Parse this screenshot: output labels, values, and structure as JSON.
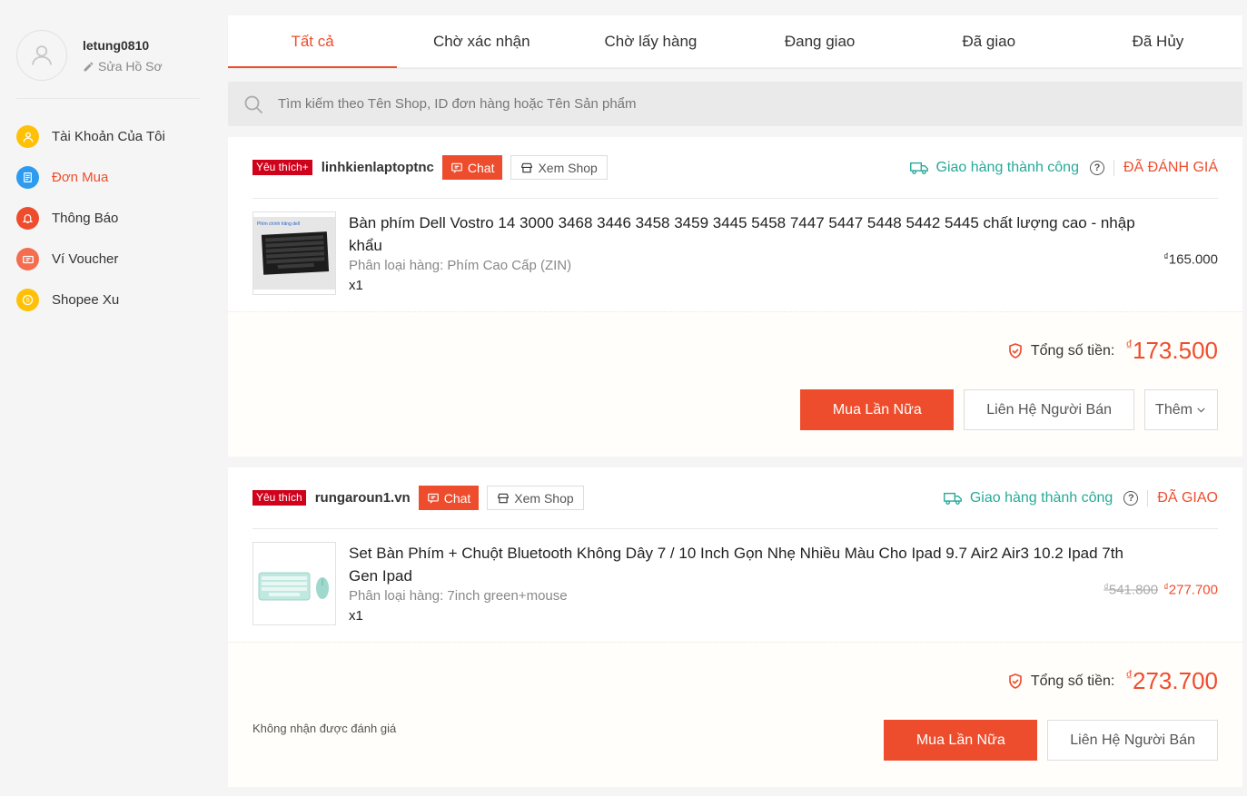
{
  "sidebar": {
    "username": "letung0810",
    "edit_label": "Sửa Hồ Sơ",
    "items": [
      {
        "label": "Tài Khoản Của Tôi",
        "icon": "user-icon",
        "color": "#ffc107"
      },
      {
        "label": "Đơn Mua",
        "icon": "clipboard-icon",
        "color": "#2d9cf0"
      },
      {
        "label": "Thông Báo",
        "icon": "bell-icon",
        "color": "#ee4d2d"
      },
      {
        "label": "Ví Voucher",
        "icon": "ticket-icon",
        "color": "#f56d4f"
      },
      {
        "label": "Shopee Xu",
        "icon": "coin-icon",
        "color": "#ffc107"
      }
    ]
  },
  "tabs": [
    "Tất cả",
    "Chờ xác nhận",
    "Chờ lấy hàng",
    "Đang giao",
    "Đã giao",
    "Đã Hủy"
  ],
  "search": {
    "placeholder": "Tìm kiếm theo Tên Shop, ID đơn hàng hoặc Tên Sản phẩm"
  },
  "orders": [
    {
      "badge": "Yêu thích+",
      "shop": "linhkienlaptoptnc",
      "chat": "Chat",
      "view_shop": "Xem Shop",
      "delivery": "Giao hàng thành công",
      "status": "ĐÃ ĐÁNH GIÁ",
      "product": {
        "name": "Bàn phím Dell Vostro 14 3000 3468 3446 3458 3459 3445 5458 7447 5447 5448 5442 5445 chất lượng cao - nhập khẩu",
        "variant": "Phân loại hàng: Phím Cao Cấp (ZIN)",
        "qty": "x1",
        "price": "165.000"
      },
      "total_label": "Tổng số tiền:",
      "total": "173.500",
      "buttons": {
        "primary": "Mua Lần Nữa",
        "contact": "Liên Hệ Người Bán",
        "more": "Thêm"
      }
    },
    {
      "badge": "Yêu thích",
      "shop": "rungaroun1.vn",
      "chat": "Chat",
      "view_shop": "Xem Shop",
      "delivery": "Giao hàng thành công",
      "status": "ĐÃ GIAO",
      "product": {
        "name": "Set Bàn Phím + Chuột Bluetooth Không Dây 7 / 10 Inch Gọn Nhẹ Nhiều Màu Cho Ipad 9.7 Air2 Air3 10.2 Ipad 7th Gen Ipad",
        "variant": "Phân loại hàng: 7inch green+mouse",
        "qty": "x1",
        "price_old": "541.800",
        "price": "277.700"
      },
      "total_label": "Tổng số tiền:",
      "total": "273.700",
      "note": "Không nhận được đánh giá",
      "buttons": {
        "primary": "Mua Lần Nữa",
        "contact": "Liên Hệ Người Bán"
      }
    }
  ],
  "currency": "₫",
  "colors": {
    "accent": "#ee4d2d",
    "success": "#26aa99",
    "badge": "#d0011b"
  }
}
